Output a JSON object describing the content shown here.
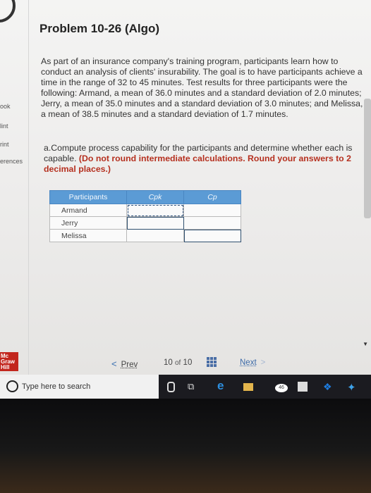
{
  "sidebar": {
    "items": [
      "ook",
      "lint",
      "rint",
      "erences"
    ]
  },
  "page": {
    "title": "Problem 10-26 (Algo)",
    "paragraph": "As part of an insurance company's training program, participants learn how to conduct an analysis of clients' insurability. The goal is to have participants achieve a time in the range of 32 to 45 minutes. Test results for three participants were the following: Armand, a mean of 36.0 minutes and a standard deviation of 2.0 minutes; Jerry, a mean of 35.0 minutes and a standard deviation of 3.0 minutes; and Melissa, a mean of 38.5 minutes and a standard deviation of 1.7 minutes.",
    "question": "a.Compute process capability for the participants and determine whether each is capable.",
    "instruction": "(Do not round intermediate calculations. Round your answers to 2 decimal places.)"
  },
  "table": {
    "headers": [
      "Participants",
      "Cpk",
      "Cp"
    ],
    "rows": [
      {
        "name": "Armand",
        "cpk": "",
        "cp": ""
      },
      {
        "name": "Jerry",
        "cpk": "",
        "cp": ""
      },
      {
        "name": "Melissa",
        "cpk": "",
        "cp": ""
      }
    ]
  },
  "logo": {
    "line1": "Mc",
    "line2": "Graw",
    "line3": "Hill",
    "color": "#c2261d"
  },
  "pagination": {
    "prev_label": "Prev",
    "current": "10",
    "of_label": "of",
    "total": "10",
    "next_label": "Next"
  },
  "taskbar": {
    "search_placeholder": "Type here to search",
    "mail_badge": "46"
  }
}
